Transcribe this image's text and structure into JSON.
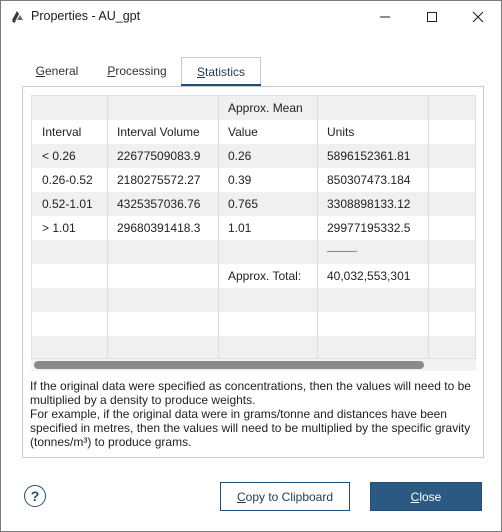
{
  "window": {
    "title": "Properties - AU_gpt"
  },
  "tabs": [
    {
      "label_u": "G",
      "label_rest": "eneral"
    },
    {
      "label_u": "P",
      "label_rest": "rocessing"
    },
    {
      "label_u": "S",
      "label_rest": "tatistics"
    }
  ],
  "table": {
    "header1": [
      "",
      "",
      "Approx. Mean",
      "",
      ""
    ],
    "header2": [
      "Interval",
      "Interval Volume",
      "Value",
      "Units",
      ""
    ],
    "rows": [
      [
        "< 0.26",
        "22677509083.9",
        "0.26",
        "5896152361.81",
        ""
      ],
      [
        "0.26-0.52",
        "2180275572.27",
        "0.39",
        "850307473.184",
        ""
      ],
      [
        "0.52-1.01",
        "4325357036.76",
        "0.765",
        "3308898133.12",
        ""
      ],
      [
        "> 1.01",
        "29680391418.3",
        "1.01",
        "29977195332.5",
        ""
      ],
      [
        "",
        "",
        "",
        "———",
        ""
      ],
      [
        "",
        "",
        "Approx. Total:",
        "40,032,553,301",
        ""
      ],
      [
        "",
        "",
        "",
        "",
        ""
      ],
      [
        "",
        "",
        "",
        "",
        ""
      ],
      [
        "",
        "",
        "",
        "",
        ""
      ]
    ]
  },
  "notes": {
    "line1": "If the original data were specified as concentrations, then the values will need to be multiplied by a density to produce weights.",
    "line2": "For example, if the original data were in grams/tonne and distances have been specified in metres, then the values will need to be multiplied by the specific gravity (tonnes/m³) to produce grams."
  },
  "buttons": {
    "help": "?",
    "copy_u": "C",
    "copy_rest": "opy to Clipboard",
    "close_u": "C",
    "close_rest": "lose"
  }
}
